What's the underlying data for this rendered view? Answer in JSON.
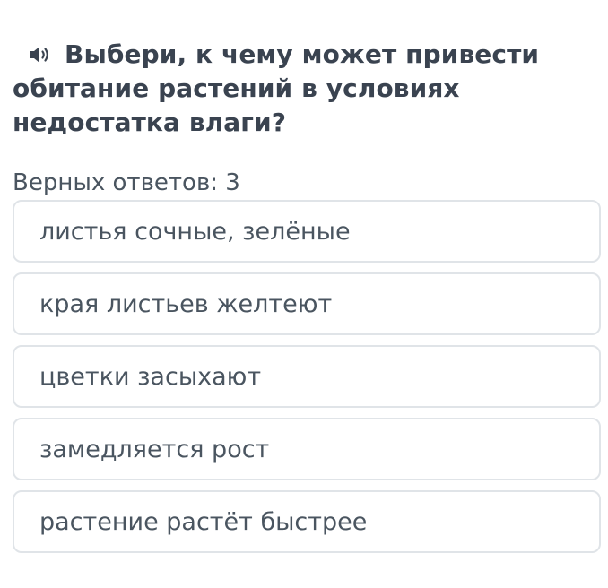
{
  "question": {
    "speaker_icon": "speaker-icon",
    "text": "Выбери, к чему может привести обитание растений в условиях недостатка влаги?"
  },
  "answers_count": "Верных ответов: 3",
  "options": [
    {
      "label": "листья сочные, зелёные"
    },
    {
      "label": "края листьев желтеют"
    },
    {
      "label": "цветки засыхают"
    },
    {
      "label": "замедляется рост"
    },
    {
      "label": "растение растёт быстрее"
    }
  ],
  "colors": {
    "text": "#3a4350",
    "option_border": "#e0e4e8",
    "background": "#ffffff"
  }
}
